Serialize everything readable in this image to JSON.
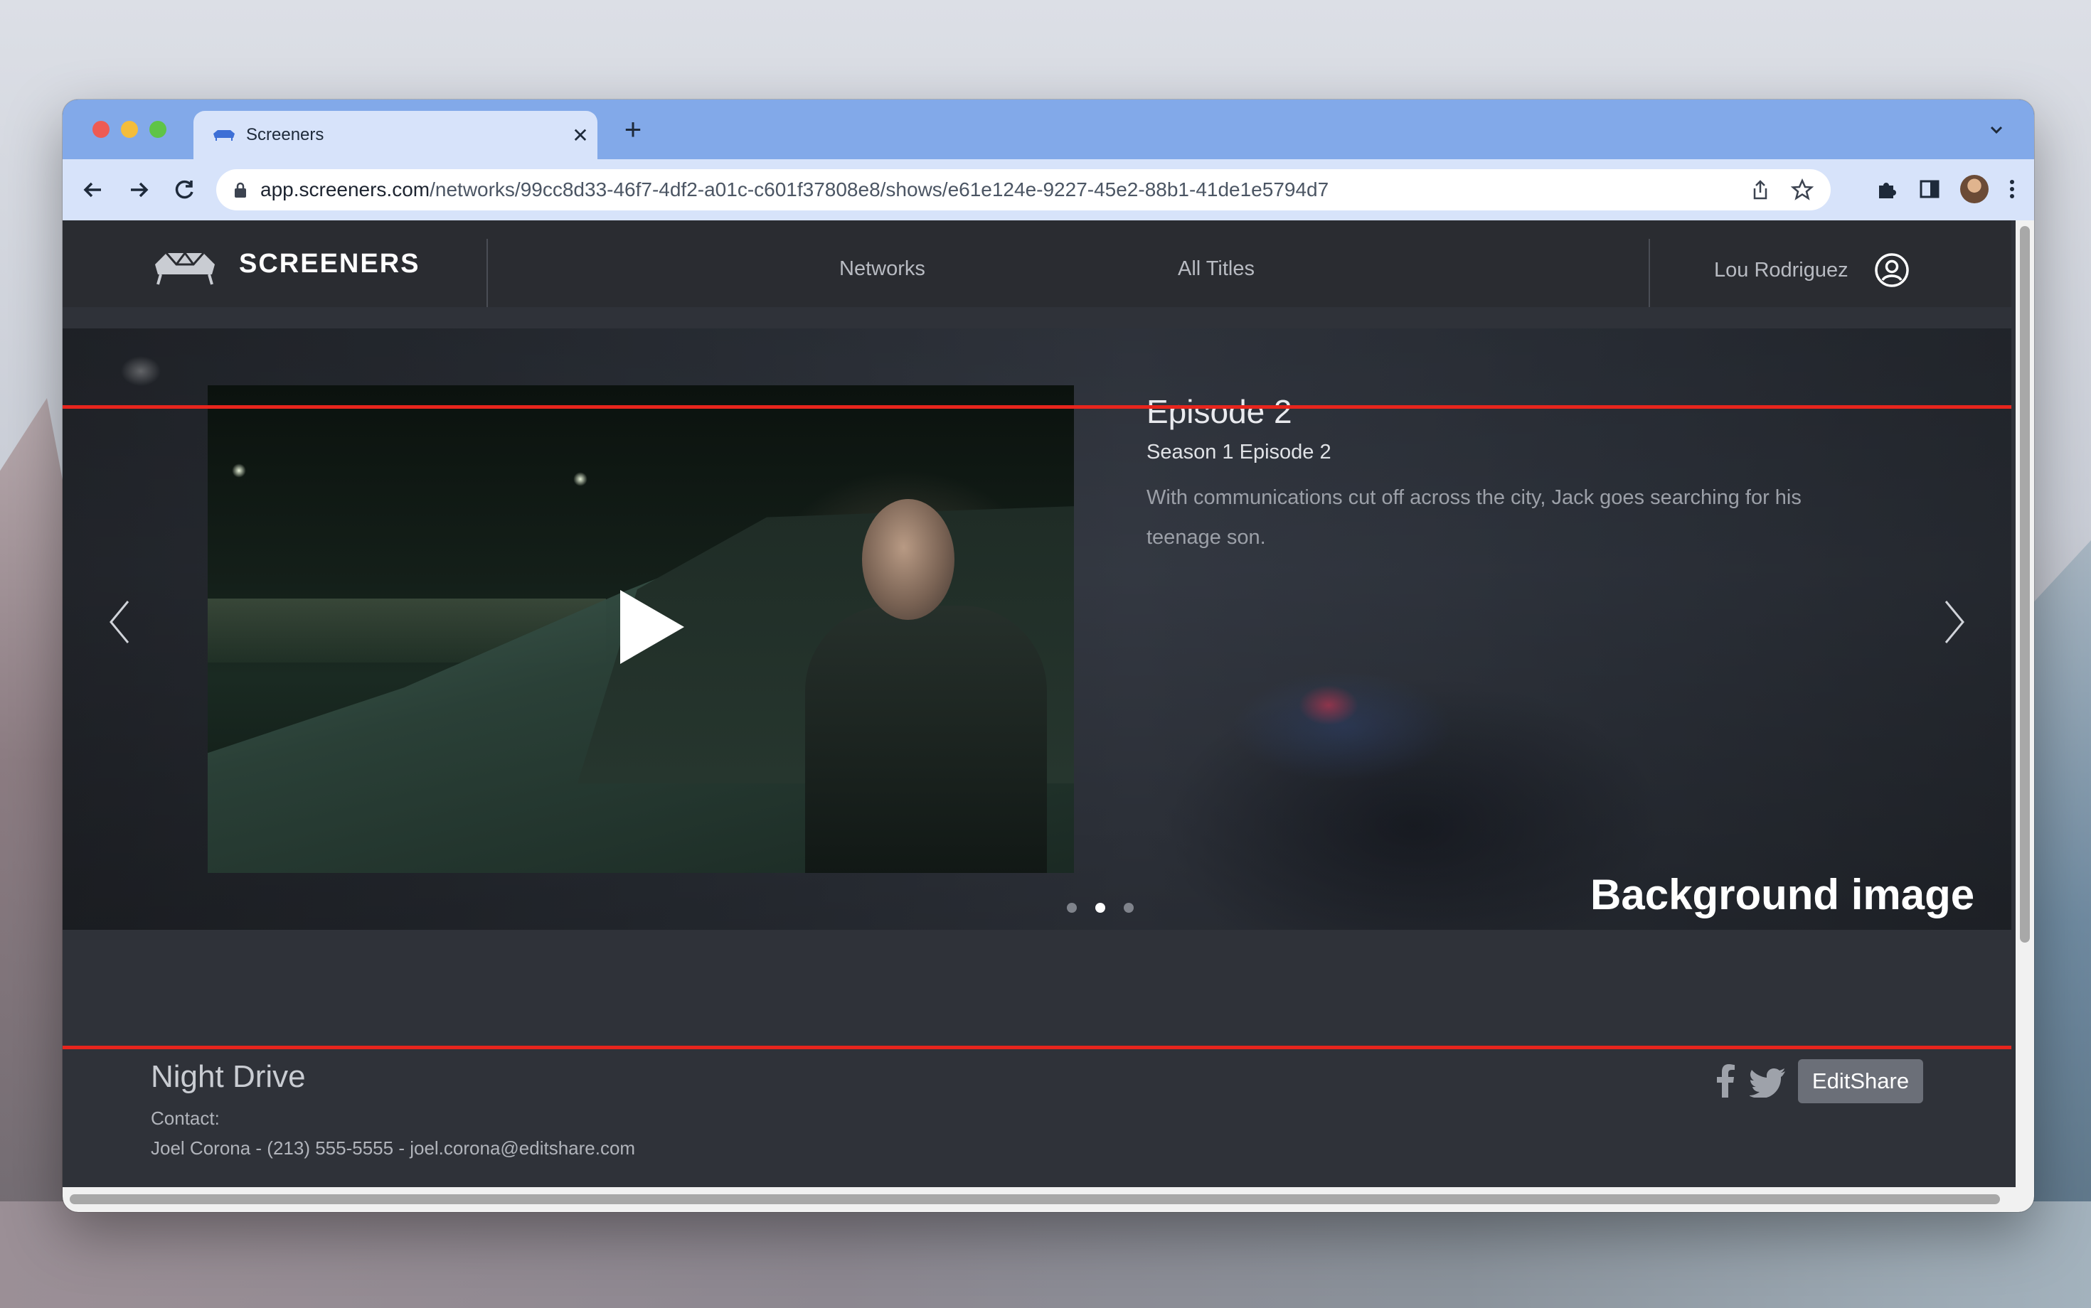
{
  "browser": {
    "tab": {
      "title": "Screeners"
    },
    "url": {
      "host": "app.screeners.com",
      "path": "/networks/99cc8d33-46f7-4df2-a01c-c601f37808e8/shows/e61e124e-9227-45e2-88b1-41de1e5794d7"
    }
  },
  "site": {
    "brand": "SCREENERS",
    "nav": [
      {
        "label": "Networks"
      },
      {
        "label": "All Titles"
      }
    ],
    "user_name": "Lou Rodriguez"
  },
  "hero": {
    "episode_title": "Episode 2",
    "episode_subtitle": "Season 1 Episode 2",
    "description": "With communications cut off across the city, Jack goes searching for his teenage son.",
    "carousel_active_index": 1,
    "carousel_count": 3
  },
  "annotation": {
    "label": "Background image",
    "color": "#e8251d"
  },
  "show": {
    "title": "Night Drive",
    "contact_label": "Contact:",
    "contact_line": "Joel Corona - (213) 555-5555 - joel.corona@editshare.com",
    "brand_button": "EditShare"
  },
  "icons": [
    "favicon-icon",
    "close-icon",
    "plus-icon",
    "chevron-down-icon",
    "back-arrow-icon",
    "forward-arrow-icon",
    "reload-icon",
    "lock-icon",
    "share-icon",
    "star-icon",
    "extensions-icon",
    "side-panel-icon",
    "avatar",
    "more-vert-icon",
    "user-circle-icon",
    "chevron-left-icon",
    "chevron-right-icon",
    "play-icon",
    "facebook-icon",
    "twitter-icon"
  ]
}
